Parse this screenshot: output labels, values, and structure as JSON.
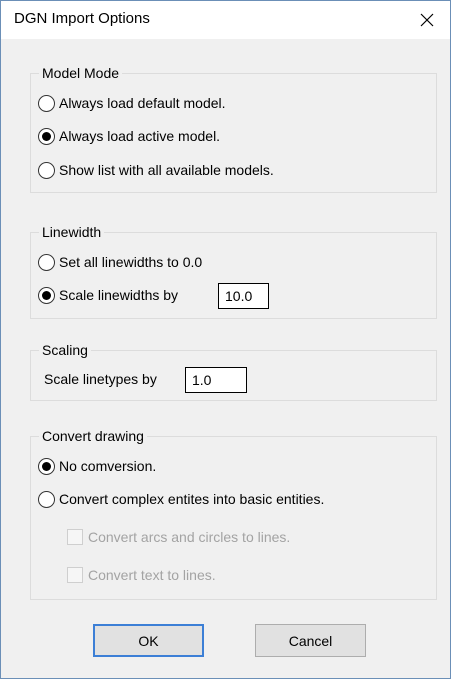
{
  "dialog": {
    "title": "DGN Import Options",
    "close_glyph": "✕"
  },
  "model_mode": {
    "legend": "Model Mode",
    "options": [
      {
        "label": "Always load default model.",
        "selected": false
      },
      {
        "label": "Always load active model.",
        "selected": true
      },
      {
        "label": "Show list with all available models.",
        "selected": false
      }
    ]
  },
  "linewidth": {
    "legend": "Linewidth",
    "options": [
      {
        "label": "Set all linewidths to 0.0",
        "selected": false
      },
      {
        "label": "Scale linewidths by",
        "selected": true
      }
    ],
    "scale_value": "10.0"
  },
  "scaling": {
    "legend": "Scaling",
    "label": "Scale linetypes by",
    "value": "1.0"
  },
  "convert_drawing": {
    "legend": "Convert drawing",
    "options": [
      {
        "label": "No comversion.",
        "selected": true
      },
      {
        "label": "Convert complex entites into basic entities.",
        "selected": false
      }
    ],
    "checkboxes": [
      {
        "label": "Convert arcs and circles to lines.",
        "checked": false,
        "enabled": false
      },
      {
        "label": "Convert text to lines.",
        "checked": false,
        "enabled": false
      }
    ]
  },
  "buttons": {
    "ok": "OK",
    "cancel": "Cancel"
  }
}
